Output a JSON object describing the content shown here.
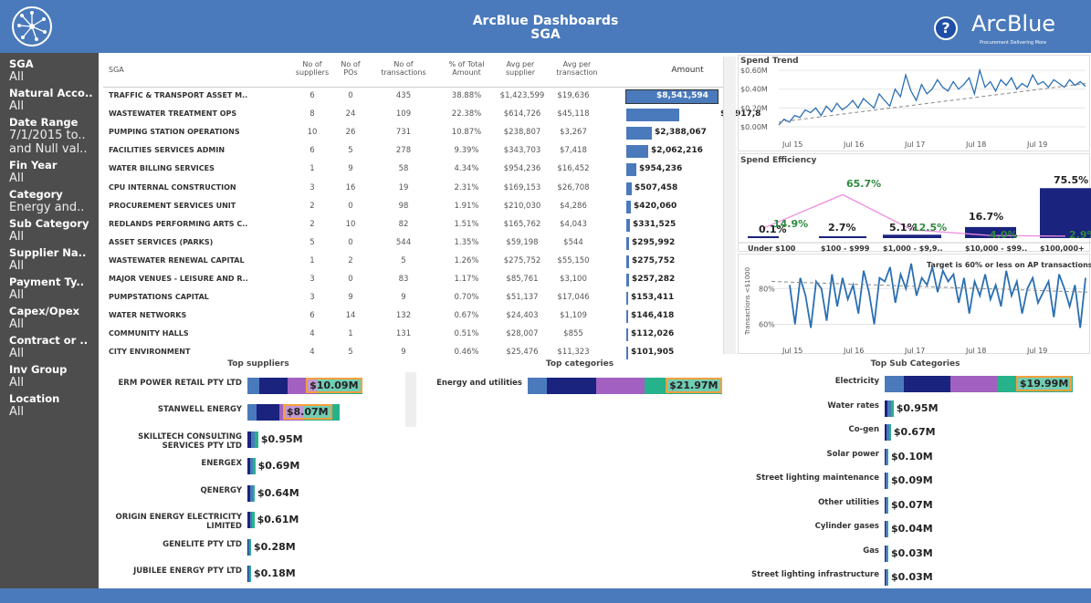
{
  "header": {
    "title_line1": "ArcBlue Dashboards",
    "title_line2": "SGA",
    "help_glyph": "?",
    "brand": "ArcBlue",
    "brand_tagline": "Procurement Delivering More"
  },
  "colors": {
    "header": "#4a7abb",
    "sidebar": "#4d4d4d",
    "bar_blue": "#4a7abb",
    "navy": "#1a237e",
    "purple": "#a261c0",
    "teal": "#26b28a",
    "orange": "#f5a03c",
    "line": "#2a6fb3",
    "pink": "#ee8ee0"
  },
  "filters": [
    {
      "title": "SGA",
      "value": "All"
    },
    {
      "title": "Natural Acco..",
      "value": "All"
    },
    {
      "title": "Date Range",
      "value": "7/1/2015 to..",
      "value2": "and Null val.."
    },
    {
      "title": "Fin Year",
      "value": "All"
    },
    {
      "title": "Category",
      "value": "Energy and.."
    },
    {
      "title": "Sub Category",
      "value": "All"
    },
    {
      "title": "Supplier Na..",
      "value": "All"
    },
    {
      "title": "Payment Ty..",
      "value": "All"
    },
    {
      "title": "Capex/Opex",
      "value": "All"
    },
    {
      "title": "Contract or ..",
      "value": "All"
    },
    {
      "title": "Inv Group",
      "value": "All"
    },
    {
      "title": "Location",
      "value": "All"
    }
  ],
  "sga_table": {
    "headers": [
      "SGA",
      "No of\nsuppliers",
      "No of\nPOs",
      "No of\ntransactions",
      "% of Total\nAmount",
      "Avg per\nsupplier",
      "Avg per\ntransaction",
      "Amount"
    ],
    "rows": [
      {
        "name": "TRAFFIC & TRANSPORT ASSET M..",
        "suppliers": "6",
        "pos": "0",
        "trans": "435",
        "pct": "38.88%",
        "avg_sup": "$1,423,599",
        "avg_tr": "$19,636",
        "amount": "$8,541,594",
        "value": 8541594
      },
      {
        "name": "WASTEWATER TREATMENT OPS",
        "suppliers": "8",
        "pos": "24",
        "trans": "109",
        "pct": "22.38%",
        "avg_sup": "$614,726",
        "avg_tr": "$45,118",
        "amount": "$4,917,8",
        "value": 4917810
      },
      {
        "name": "PUMPING STATION OPERATIONS",
        "suppliers": "10",
        "pos": "26",
        "trans": "731",
        "pct": "10.87%",
        "avg_sup": "$238,807",
        "avg_tr": "$3,267",
        "amount": "$2,388,067",
        "value": 2388067
      },
      {
        "name": "FACILITIES SERVICES ADMIN",
        "suppliers": "6",
        "pos": "5",
        "trans": "278",
        "pct": "9.39%",
        "avg_sup": "$343,703",
        "avg_tr": "$7,418",
        "amount": "$2,062,216",
        "value": 2062216
      },
      {
        "name": "WATER BILLING SERVICES",
        "suppliers": "1",
        "pos": "9",
        "trans": "58",
        "pct": "4.34%",
        "avg_sup": "$954,236",
        "avg_tr": "$16,452",
        "amount": "$954,236",
        "value": 954236
      },
      {
        "name": "CPU INTERNAL CONSTRUCTION",
        "suppliers": "3",
        "pos": "16",
        "trans": "19",
        "pct": "2.31%",
        "avg_sup": "$169,153",
        "avg_tr": "$26,708",
        "amount": "$507,458",
        "value": 507458
      },
      {
        "name": "PROCUREMENT SERVICES UNIT",
        "suppliers": "2",
        "pos": "0",
        "trans": "98",
        "pct": "1.91%",
        "avg_sup": "$210,030",
        "avg_tr": "$4,286",
        "amount": "$420,060",
        "value": 420060
      },
      {
        "name": "REDLANDS PERFORMING ARTS C..",
        "suppliers": "2",
        "pos": "10",
        "trans": "82",
        "pct": "1.51%",
        "avg_sup": "$165,762",
        "avg_tr": "$4,043",
        "amount": "$331,525",
        "value": 331525
      },
      {
        "name": "ASSET SERVICES (PARKS)",
        "suppliers": "5",
        "pos": "0",
        "trans": "544",
        "pct": "1.35%",
        "avg_sup": "$59,198",
        "avg_tr": "$544",
        "amount": "$295,992",
        "value": 295992
      },
      {
        "name": "WASTEWATER RENEWAL CAPITAL",
        "suppliers": "1",
        "pos": "2",
        "trans": "5",
        "pct": "1.26%",
        "avg_sup": "$275,752",
        "avg_tr": "$55,150",
        "amount": "$275,752",
        "value": 275752
      },
      {
        "name": "MAJOR VENUES - LEISURE AND R..",
        "suppliers": "3",
        "pos": "0",
        "trans": "83",
        "pct": "1.17%",
        "avg_sup": "$85,761",
        "avg_tr": "$3,100",
        "amount": "$257,282",
        "value": 257282
      },
      {
        "name": "PUMPSTATIONS CAPITAL",
        "suppliers": "3",
        "pos": "9",
        "trans": "9",
        "pct": "0.70%",
        "avg_sup": "$51,137",
        "avg_tr": "$17,046",
        "amount": "$153,411",
        "value": 153411
      },
      {
        "name": "WATER NETWORKS",
        "suppliers": "6",
        "pos": "14",
        "trans": "132",
        "pct": "0.67%",
        "avg_sup": "$24,403",
        "avg_tr": "$1,109",
        "amount": "$146,418",
        "value": 146418
      },
      {
        "name": "COMMUNITY HALLS",
        "suppliers": "4",
        "pos": "1",
        "trans": "131",
        "pct": "0.51%",
        "avg_sup": "$28,007",
        "avg_tr": "$855",
        "amount": "$112,026",
        "value": 112026
      },
      {
        "name": "CITY ENVIRONMENT",
        "suppliers": "4",
        "pos": "5",
        "trans": "9",
        "pct": "0.46%",
        "avg_sup": "$25,476",
        "avg_tr": "$11,323",
        "amount": "$101,905",
        "value": 101905
      }
    ]
  },
  "chart_data": [
    {
      "type": "line",
      "title": "Spend Trend",
      "x_ticks": [
        "Jul 15",
        "Jul 16",
        "Jul 17",
        "Jul 18",
        "Jul 19"
      ],
      "y_ticks": [
        "$0.00M",
        "$0.20M",
        "$0.40M",
        "$0.60M"
      ],
      "ylim": [
        0,
        0.62
      ],
      "series": [
        {
          "values": [
            0.02,
            0.08,
            0.05,
            0.12,
            0.1,
            0.18,
            0.15,
            0.2,
            0.12,
            0.22,
            0.16,
            0.25,
            0.18,
            0.22,
            0.28,
            0.2,
            0.3,
            0.25,
            0.2,
            0.35,
            0.28,
            0.22,
            0.4,
            0.32,
            0.55,
            0.38,
            0.28,
            0.45,
            0.35,
            0.4,
            0.5,
            0.42,
            0.38,
            0.48,
            0.4,
            0.45,
            0.52,
            0.35,
            0.6,
            0.42,
            0.48,
            0.38,
            0.5,
            0.44,
            0.52,
            0.4,
            0.46,
            0.42,
            0.55,
            0.45,
            0.48,
            0.42,
            0.5,
            0.46,
            0.42,
            0.5,
            0.44,
            0.48,
            0.43
          ]
        }
      ],
      "trendline": [
        0.05,
        0.46
      ]
    },
    {
      "type": "bar",
      "title": "Spend Efficiency",
      "categories": [
        "Under $100",
        "$100 - $999",
        "$1,000 - $9,9..",
        "$10,000 - $99..",
        "$100,000+"
      ],
      "series": [
        {
          "values": [
            0.1,
            2.7,
            5.1,
            16.7,
            75.5
          ]
        },
        {
          "values": [
            14.9,
            65.7,
            12.5,
            4.0,
            2.9
          ]
        }
      ],
      "labels_bar": [
        "0.1%",
        "2.7%",
        "5.1%",
        "16.7%",
        "75.5%"
      ],
      "labels_line": [
        "14.9%",
        "65.7%",
        "12.5%",
        "4.0%",
        "2.9%"
      ]
    },
    {
      "type": "line",
      "title": "Target is 60% or less on AP transactions",
      "ylabel": "Transactions <$1000",
      "x_ticks": [
        "Jul 15",
        "Jul 16",
        "Jul 17",
        "Jul 18",
        "Jul 19"
      ],
      "y_ticks": [
        "60%",
        "80%"
      ],
      "ylim": [
        48,
        96
      ],
      "series": [
        {
          "values": [
            82,
            60,
            86,
            76,
            58,
            84,
            80,
            62,
            88,
            70,
            86,
            74,
            82,
            66,
            90,
            78,
            60,
            86,
            84,
            92,
            72,
            88,
            80,
            94,
            76,
            86,
            82,
            92,
            78,
            90,
            84,
            88,
            72,
            86,
            66,
            84,
            76,
            88,
            74,
            82,
            70,
            90,
            76,
            84,
            66,
            80,
            86,
            72,
            78,
            84,
            64,
            88,
            80,
            70,
            82,
            58,
            86
          ]
        }
      ],
      "trendline": [
        84,
        78
      ]
    }
  ],
  "top_suppliers": {
    "title": "Top suppliers",
    "items": [
      {
        "name": "ERM POWER RETAIL PTY LTD",
        "label": "$10.09M",
        "value": 10.09
      },
      {
        "name": "STANWELL ENERGY",
        "label": "$8.07M",
        "value": 8.07
      },
      {
        "name": "SKILLTECH CONSULTING SERVICES PTY LTD",
        "label": "$0.95M",
        "value": 0.95
      },
      {
        "name": "ENERGEX",
        "label": "$0.69M",
        "value": 0.69
      },
      {
        "name": "QENERGY",
        "label": "$0.64M",
        "value": 0.64
      },
      {
        "name": "ORIGIN ENERGY ELECTRICITY LIMITED",
        "label": "$0.61M",
        "value": 0.61
      },
      {
        "name": "GENELITE PTY LTD",
        "label": "$0.28M",
        "value": 0.28
      },
      {
        "name": "JUBILEE ENERGY PTY LTD",
        "label": "$0.18M",
        "value": 0.18
      }
    ]
  },
  "top_categories": {
    "title": "Top categories",
    "items": [
      {
        "name": "Energy and utilities",
        "label": "$21.97M",
        "value": 21.97
      }
    ]
  },
  "top_subcategories": {
    "title": "Top Sub Categories",
    "items": [
      {
        "name": "Electricity",
        "label": "$19.99M",
        "value": 19.99
      },
      {
        "name": "Water rates",
        "label": "$0.95M",
        "value": 0.95
      },
      {
        "name": "Co-gen",
        "label": "$0.67M",
        "value": 0.67
      },
      {
        "name": "Solar power",
        "label": "$0.10M",
        "value": 0.1
      },
      {
        "name": "Street lighting maintenance",
        "label": "$0.09M",
        "value": 0.09
      },
      {
        "name": "Other utilities",
        "label": "$0.07M",
        "value": 0.07
      },
      {
        "name": "Cylinder gases",
        "label": "$0.04M",
        "value": 0.04
      },
      {
        "name": "Gas",
        "label": "$0.03M",
        "value": 0.03
      },
      {
        "name": "Street lighting infrastructure",
        "label": "$0.03M",
        "value": 0.03
      }
    ]
  }
}
